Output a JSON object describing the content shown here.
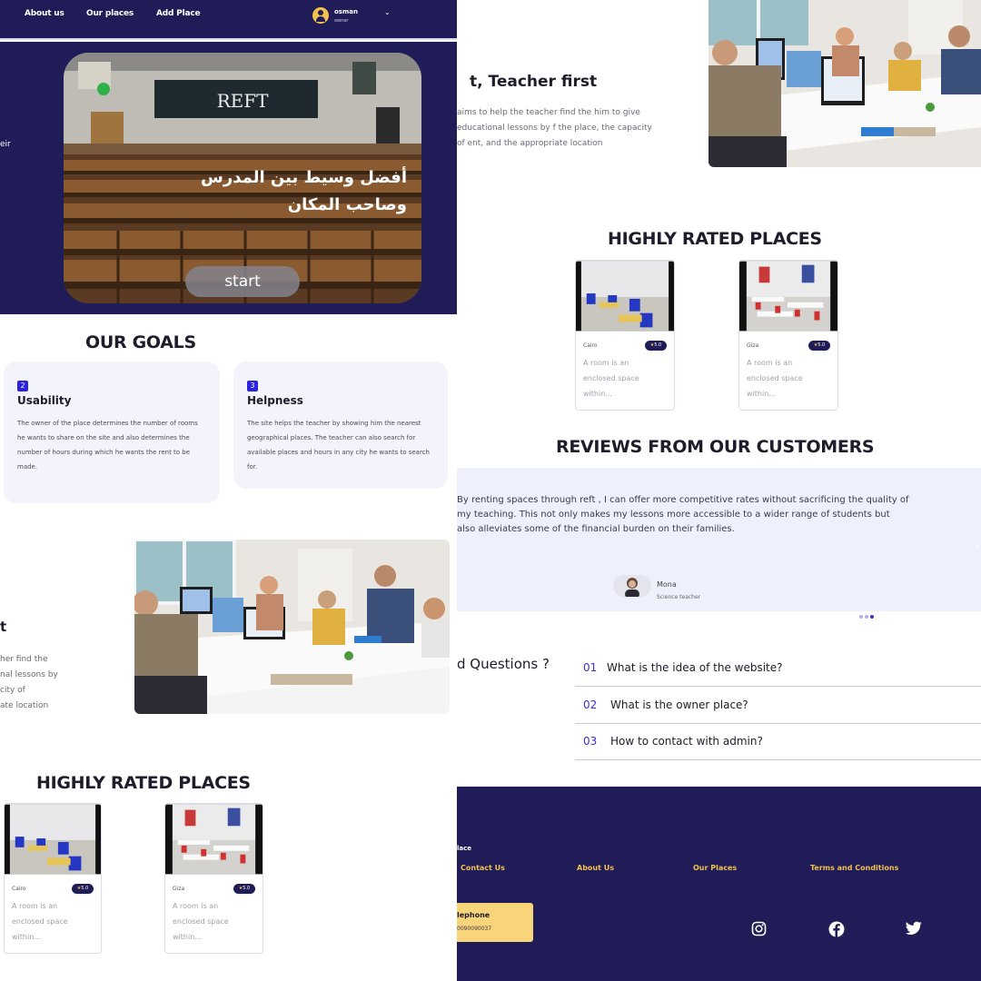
{
  "nav": {
    "links": [
      "About us",
      "Our places",
      "Add Place"
    ],
    "user_name": "osman",
    "user_role": "owner",
    "caret": "⌄"
  },
  "hero": {
    "edge_text": "eir",
    "banner_text": "REFT",
    "arabic_text": "أفضل وسيط بين المدرس\nوصاحب المكان",
    "start_label": "start"
  },
  "goals": {
    "title": "OUR GOALS",
    "cards": [
      {
        "num": "2",
        "title": "Usability",
        "text": "The owner of the place determines the number of rooms he wants to share on the site and also determines the number of hours during which he wants the rent to be made."
      },
      {
        "num": "3",
        "title": "Helpness",
        "text": "The site helps the teacher by showing him the nearest geographical places. The teacher can also search for available places and hours in any city he wants to search for."
      }
    ]
  },
  "feature_left": {
    "heading_fragment": "t",
    "lines": [
      "her find the",
      "nal lessons by",
      "city of",
      "ate location"
    ]
  },
  "places": {
    "title": "HIGHLY RATED PLACES",
    "items": [
      {
        "city": "Cairo",
        "rating": "5.0",
        "desc": "A room is an enclosed space within..."
      },
      {
        "city": "Giza",
        "rating": "5.0",
        "desc": "A room is an enclosed space within..."
      }
    ]
  },
  "intro": {
    "heading": "t, Teacher first",
    "text": "aims to help the teacher find the him to give educational lessons by f the place, the capacity of ent, and the appropriate location"
  },
  "reviews": {
    "title": "REVIEWS FROM OUR CUSTOMERS",
    "text": "By renting spaces through reft , I can offer more competitive rates without sacrificing the quality of my teaching. This not only makes my lessons more accessible to a wider range of students but also alleviates some of the financial burden on their families.",
    "reviewer_name": "Mona",
    "reviewer_role": "Science teacher",
    "arrow": "›"
  },
  "faq": {
    "title": "d Questions ?",
    "items": [
      {
        "num": "01",
        "q": "What is the idea of the website?"
      },
      {
        "num": "02",
        "q": "What is the owner place?"
      },
      {
        "num": "03",
        "q": "How to contact with admin?"
      }
    ]
  },
  "footer": {
    "brand": "lace",
    "links": [
      "Contact Us",
      "About Us",
      "Our Places",
      "Terms and Conditions"
    ],
    "phone_label": "lephone",
    "phone_number": "0090090037",
    "socials": [
      "instagram-icon",
      "facebook-icon",
      "twitter-icon"
    ]
  },
  "colors": {
    "navy": "#1f1c57",
    "accent_yellow": "#f2c14e",
    "accent_blue": "#3b2fd6",
    "card_bg": "#f3f4fb",
    "reviews_bg": "#eef1fb"
  }
}
